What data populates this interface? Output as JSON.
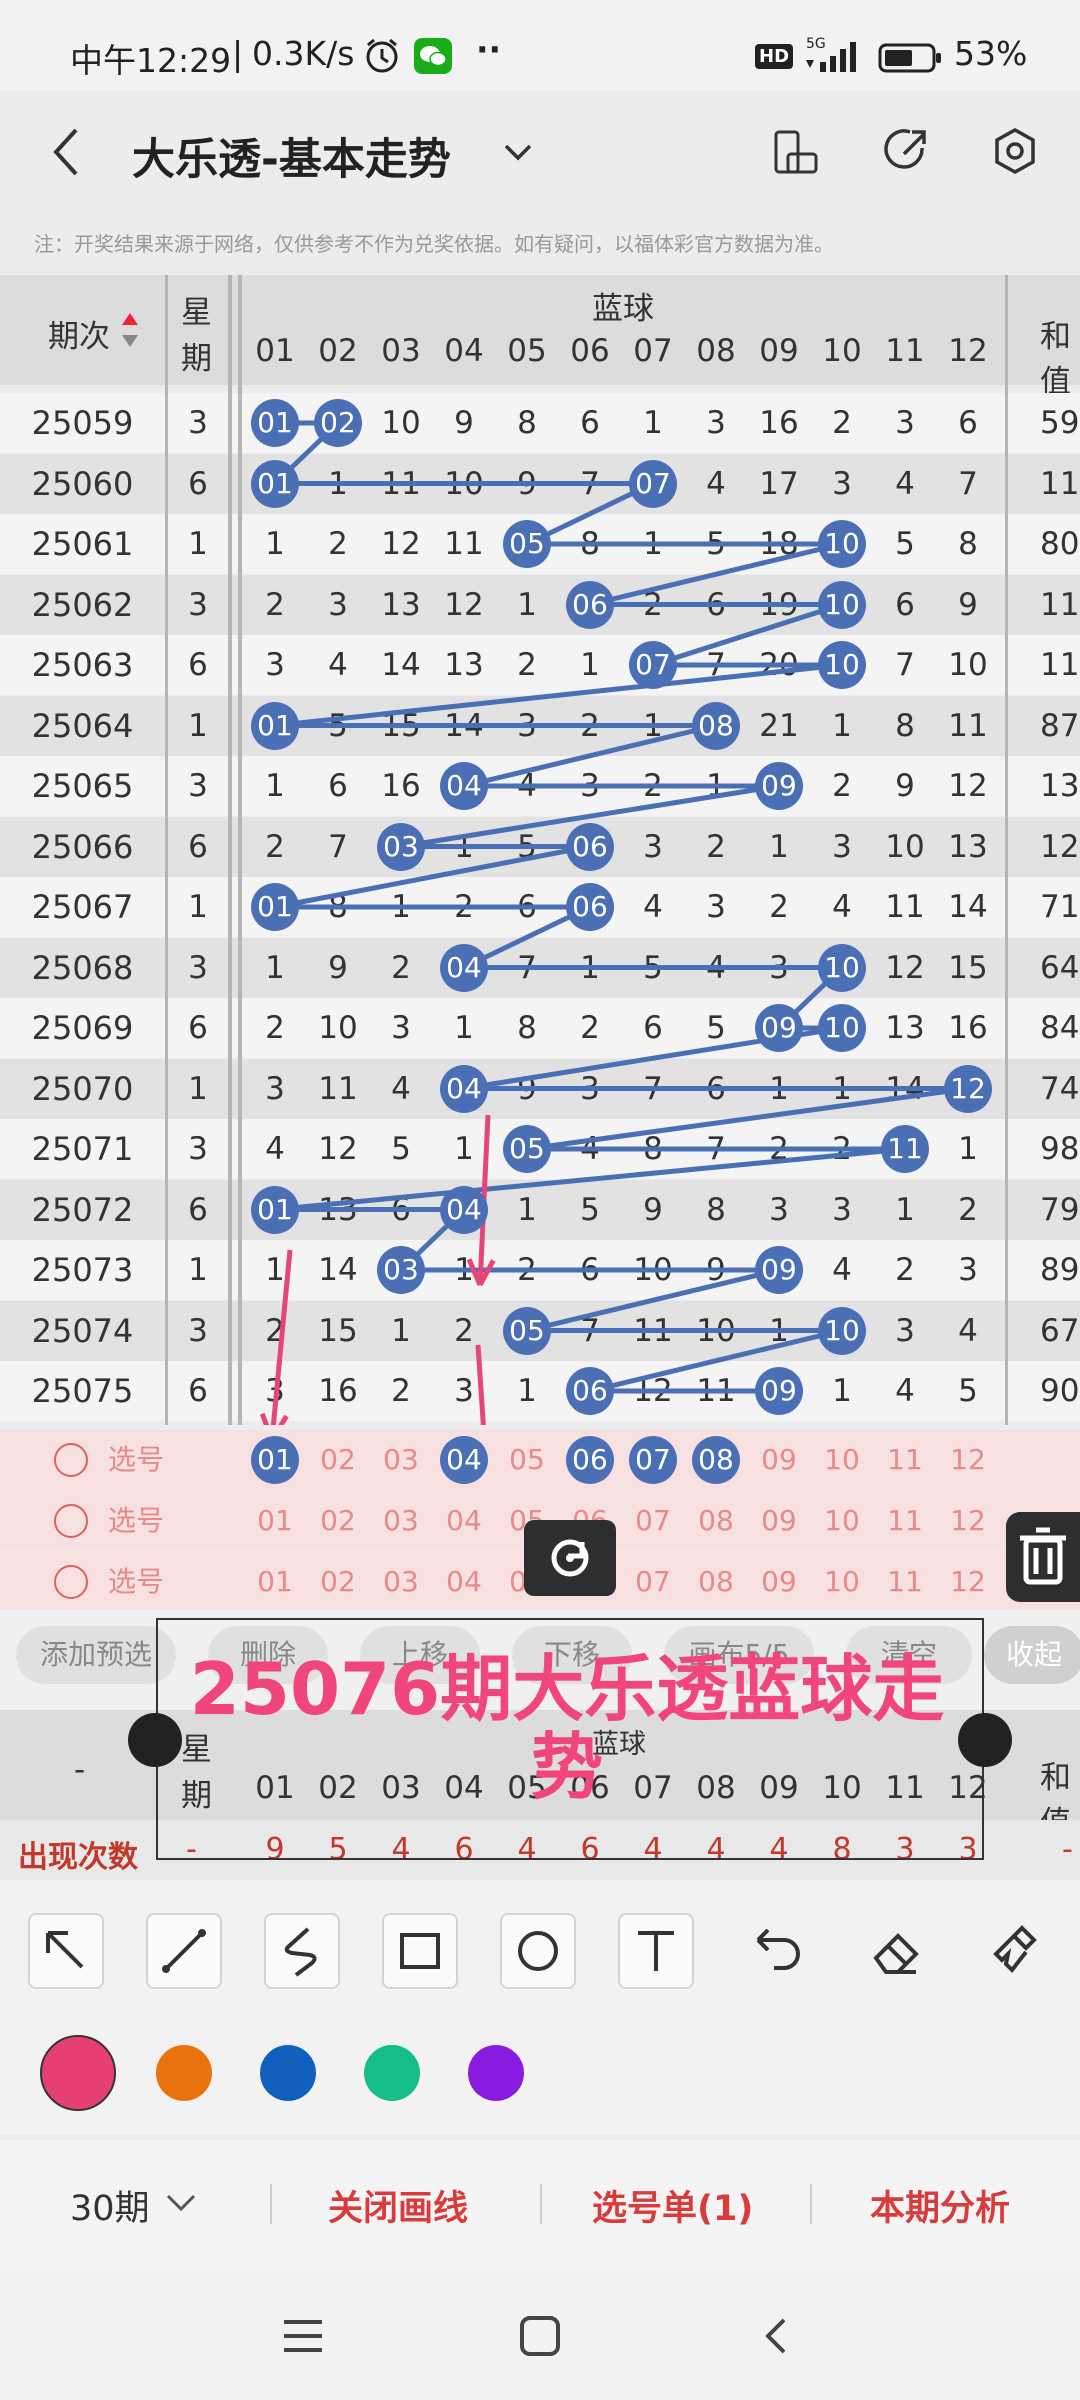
{
  "status_bar": {
    "time": "中午12:29",
    "net_speed": "0.3K/s",
    "signal": "5G",
    "hd_label": "HD",
    "battery": "53%"
  },
  "header": {
    "title": "大乐透-基本走势"
  },
  "notice": "注：开奖结果来源于网络，仅供参考不作为兑奖依据。如有疑问，以福体彩官方数据为准。",
  "table_header": {
    "period": "期次",
    "week_line1": "星",
    "week_line2": "期",
    "blue_ball": "蓝球",
    "sum": "和值",
    "numbers": [
      "01",
      "02",
      "03",
      "04",
      "05",
      "06",
      "07",
      "08",
      "09",
      "10",
      "11",
      "12"
    ]
  },
  "rows": [
    {
      "period": "25059",
      "week": "3",
      "vals": [
        "01",
        "02",
        "10",
        "9",
        "8",
        "6",
        "1",
        "3",
        "16",
        "2",
        "3",
        "6"
      ],
      "hits": [
        1,
        2
      ],
      "sum": "59"
    },
    {
      "period": "25060",
      "week": "6",
      "vals": [
        "01",
        "1",
        "11",
        "10",
        "9",
        "7",
        "07",
        "4",
        "17",
        "3",
        "4",
        "7"
      ],
      "hits": [
        1,
        7
      ],
      "sum": "11"
    },
    {
      "period": "25061",
      "week": "1",
      "vals": [
        "1",
        "2",
        "12",
        "11",
        "05",
        "8",
        "1",
        "5",
        "18",
        "10",
        "5",
        "8"
      ],
      "hits": [
        5,
        10
      ],
      "sum": "80"
    },
    {
      "period": "25062",
      "week": "3",
      "vals": [
        "2",
        "3",
        "13",
        "12",
        "1",
        "06",
        "2",
        "6",
        "19",
        "10",
        "6",
        "9"
      ],
      "hits": [
        6,
        10
      ],
      "sum": "11"
    },
    {
      "period": "25063",
      "week": "6",
      "vals": [
        "3",
        "4",
        "14",
        "13",
        "2",
        "1",
        "07",
        "7",
        "20",
        "10",
        "7",
        "10"
      ],
      "hits": [
        7,
        10
      ],
      "sum": "11"
    },
    {
      "period": "25064",
      "week": "1",
      "vals": [
        "01",
        "5",
        "15",
        "14",
        "3",
        "2",
        "1",
        "08",
        "21",
        "1",
        "8",
        "11"
      ],
      "hits": [
        1,
        8
      ],
      "sum": "87"
    },
    {
      "period": "25065",
      "week": "3",
      "vals": [
        "1",
        "6",
        "16",
        "04",
        "4",
        "3",
        "2",
        "1",
        "09",
        "2",
        "9",
        "12"
      ],
      "hits": [
        4,
        9
      ],
      "sum": "13"
    },
    {
      "period": "25066",
      "week": "6",
      "vals": [
        "2",
        "7",
        "03",
        "1",
        "5",
        "06",
        "3",
        "2",
        "1",
        "3",
        "10",
        "13"
      ],
      "hits": [
        3,
        6
      ],
      "sum": "12"
    },
    {
      "period": "25067",
      "week": "1",
      "vals": [
        "01",
        "8",
        "1",
        "2",
        "6",
        "06",
        "4",
        "3",
        "2",
        "4",
        "11",
        "14"
      ],
      "hits": [
        1,
        6
      ],
      "sum": "71"
    },
    {
      "period": "25068",
      "week": "3",
      "vals": [
        "1",
        "9",
        "2",
        "04",
        "7",
        "1",
        "5",
        "4",
        "3",
        "10",
        "12",
        "15"
      ],
      "hits": [
        4,
        10
      ],
      "sum": "64"
    },
    {
      "period": "25069",
      "week": "6",
      "vals": [
        "2",
        "10",
        "3",
        "1",
        "8",
        "2",
        "6",
        "5",
        "09",
        "10",
        "13",
        "16"
      ],
      "hits": [
        9,
        10
      ],
      "sum": "84"
    },
    {
      "period": "25070",
      "week": "1",
      "vals": [
        "3",
        "11",
        "4",
        "04",
        "9",
        "3",
        "7",
        "6",
        "1",
        "1",
        "14",
        "12"
      ],
      "hits": [
        4,
        12
      ],
      "sum": "74"
    },
    {
      "period": "25071",
      "week": "3",
      "vals": [
        "4",
        "12",
        "5",
        "1",
        "05",
        "4",
        "8",
        "7",
        "2",
        "2",
        "11",
        "1"
      ],
      "hits": [
        5,
        11
      ],
      "sum": "98"
    },
    {
      "period": "25072",
      "week": "6",
      "vals": [
        "01",
        "13",
        "6",
        "04",
        "1",
        "5",
        "9",
        "8",
        "3",
        "3",
        "1",
        "2"
      ],
      "hits": [
        1,
        4
      ],
      "sum": "79"
    },
    {
      "period": "25073",
      "week": "1",
      "vals": [
        "1",
        "14",
        "03",
        "1",
        "2",
        "6",
        "10",
        "9",
        "09",
        "4",
        "2",
        "3"
      ],
      "hits": [
        3,
        9
      ],
      "sum": "89"
    },
    {
      "period": "25074",
      "week": "3",
      "vals": [
        "2",
        "15",
        "1",
        "2",
        "05",
        "7",
        "11",
        "10",
        "1",
        "10",
        "3",
        "4"
      ],
      "hits": [
        5,
        10
      ],
      "sum": "67"
    },
    {
      "period": "25075",
      "week": "6",
      "vals": [
        "3",
        "16",
        "2",
        "3",
        "1",
        "06",
        "12",
        "11",
        "09",
        "1",
        "4",
        "5"
      ],
      "hits": [
        6,
        9
      ],
      "sum": "90"
    }
  ],
  "pick_rows": [
    {
      "label": "选号",
      "selected": [
        1,
        4,
        6,
        7,
        8
      ]
    },
    {
      "label": "选号",
      "selected": []
    },
    {
      "label": "选号",
      "selected": []
    }
  ],
  "actions": [
    "添加预选",
    "删除",
    "上移",
    "下移",
    "画布5/5",
    "清空",
    "收起"
  ],
  "stats": {
    "label": "出现次数",
    "dash": "-",
    "counts": [
      "9",
      "5",
      "4",
      "6",
      "4",
      "6",
      "4",
      "4",
      "4",
      "8",
      "3",
      "3"
    ]
  },
  "annotation_text": "25076期大乐透蓝球走势",
  "palette": {
    "colors": [
      "#e63f74",
      "#ea7310",
      "#1160be",
      "#16bd88",
      "#8a1be0"
    ],
    "selected": 0
  },
  "bottom": {
    "period_select": "30期",
    "close_lines": "关闭画线",
    "pick_list": "选号单(1)",
    "analysis": "本期分析"
  }
}
